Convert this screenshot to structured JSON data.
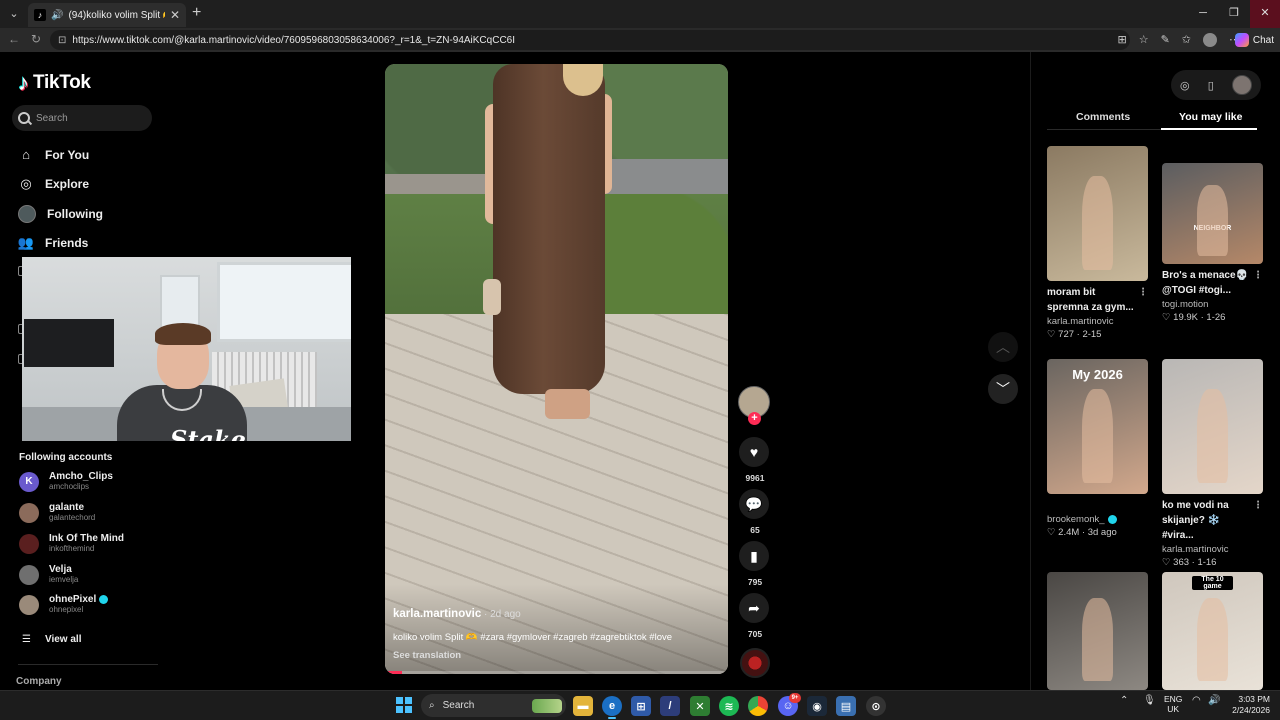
{
  "browser": {
    "tab_title": "(94)koliko volim Split 🫶 #zar",
    "url": "https://www.tiktok.com/@karla.martinovic/video/7609596803058634006?_r=1&_t=ZN-94AiKCqCC6I",
    "chat_label": "Chat"
  },
  "tiktok": {
    "brand": "TikTok",
    "search_placeholder": "Search",
    "menu": [
      "For You",
      "Explore",
      "Following",
      "Friends"
    ],
    "following_title": "Following accounts",
    "accounts": [
      {
        "name": "Amcho_Clips",
        "username": "amchoclips",
        "color": "#6a5acd",
        "initial": "K",
        "verified": false
      },
      {
        "name": "galante",
        "username": "galantechord",
        "color": "#8b6b5b",
        "initial": "",
        "verified": false
      },
      {
        "name": "Ink Of The Mind",
        "username": "inkofthemind",
        "color": "#5a1f1f",
        "initial": "",
        "verified": false
      },
      {
        "name": "Velja",
        "username": "iemvelja",
        "color": "#6f6f6f",
        "initial": "",
        "verified": false
      },
      {
        "name": "ohnePixel",
        "username": "ohnepixel",
        "color": "#9a8a7a",
        "initial": "",
        "verified": true
      }
    ],
    "view_all": "View all",
    "company": "Company"
  },
  "webcam": {
    "watermark": "Stake"
  },
  "video": {
    "author": "karla.martinovic",
    "age": " · 2d ago",
    "caption": "koliko volim Split 🫶 #zara #gymlover #zagreb #zagrebtiktok #love",
    "translate": "See translation",
    "progress": 0.05,
    "likes": "9961",
    "comments": "65",
    "saves": "795",
    "shares": "705"
  },
  "panel": {
    "tab_comments": "Comments",
    "tab_you_may_like": "You may like",
    "cards": [
      {
        "title": "moram bit spremna za gym...",
        "user": "karla.martinovic",
        "stats": "♡ 727 · 2-15",
        "verified": false,
        "label": "",
        "colors": [
          "#8b7a62",
          "#c9b99c"
        ]
      },
      {
        "title": "Bro's a menace💀 @TOGI #togi...",
        "user": "togi.motion",
        "stats": "♡ 19.9K · 1-26",
        "verified": false,
        "label": "NEIGHBOR",
        "colors": [
          "#5b5d60",
          "#b58868"
        ]
      },
      {
        "title": "",
        "user": "brookemonk_",
        "stats": "♡ 2.4M · 3d ago",
        "verified": true,
        "label": "My 2026",
        "colors": [
          "#6a6560",
          "#d2a88c"
        ]
      },
      {
        "title": "ko me vodi na skijanje? ❄️ #vira...",
        "user": "karla.martinovic",
        "stats": "♡ 363 · 1-16",
        "verified": false,
        "label": "",
        "colors": [
          "#b9b7b5",
          "#e4d6c9"
        ]
      },
      {
        "title": "",
        "user": "",
        "stats": "",
        "verified": false,
        "label": "",
        "colors": [
          "#4a4744",
          "#8d8882"
        ]
      },
      {
        "title": "",
        "user": "",
        "stats": "",
        "verified": false,
        "label": "The 10 game",
        "colors": [
          "#cfc7bd",
          "#e9e2d8"
        ]
      }
    ]
  },
  "taskbar": {
    "search": "Search",
    "lang_top": "ENG",
    "lang_bottom": "UK",
    "time": "3:03 PM",
    "date": "2/24/2026",
    "badge": "9+"
  }
}
